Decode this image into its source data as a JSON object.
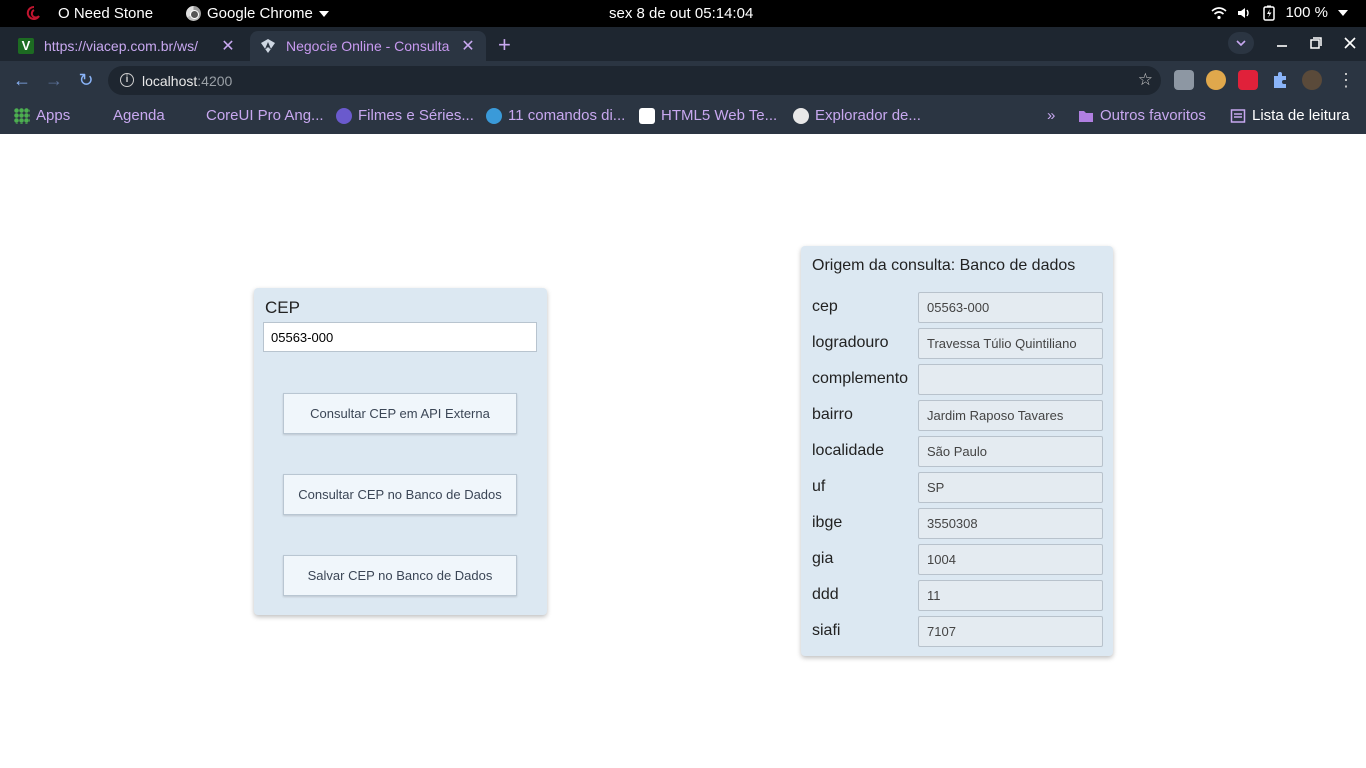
{
  "os_bar": {
    "app_name": "O Need Stone",
    "browser_menu": "Google Chrome",
    "clock": "sex 8 de out  05:14:04",
    "battery": "100 %"
  },
  "tabs": [
    {
      "title": "https://viacep.com.br/ws/",
      "favicon": "V"
    },
    {
      "title": "Negocie Online - Consulta",
      "favicon": "angular-icon"
    }
  ],
  "address_bar": {
    "host": "localhost",
    "port": ":4200"
  },
  "bookmarks": [
    {
      "label": "Apps"
    },
    {
      "label": "Agenda"
    },
    {
      "label": "CoreUI Pro Ang..."
    },
    {
      "label": "Filmes e Séries..."
    },
    {
      "label": "11 comandos di..."
    },
    {
      "label": "HTML5 Web Te..."
    },
    {
      "label": "Explorador de..."
    }
  ],
  "bookmarks_more": "»",
  "other_bookmarks": "Outros favoritos",
  "reading_list": "Lista de leitura",
  "form": {
    "label": "CEP",
    "cep_value": "05563-000",
    "buttons": [
      "Consultar CEP em API Externa",
      "Consultar CEP no Banco de Dados",
      "Salvar CEP no Banco de Dados"
    ]
  },
  "result": {
    "heading": "Origem da consulta: Banco de dados",
    "fields": [
      {
        "key": "cep",
        "value": "05563-000"
      },
      {
        "key": "logradouro",
        "value": "Travessa Túlio Quintiliano"
      },
      {
        "key": "complemento",
        "value": ""
      },
      {
        "key": "bairro",
        "value": "Jardim Raposo Tavares"
      },
      {
        "key": "localidade",
        "value": "São Paulo"
      },
      {
        "key": "uf",
        "value": "SP"
      },
      {
        "key": "ibge",
        "value": "3550308"
      },
      {
        "key": "gia",
        "value": "1004"
      },
      {
        "key": "ddd",
        "value": "11"
      },
      {
        "key": "siafi",
        "value": "7107"
      }
    ]
  },
  "colors": {
    "card_bg": "#dce8f2",
    "chrome_frame": "#2b3542",
    "tab_text": "#c8a8f0"
  }
}
